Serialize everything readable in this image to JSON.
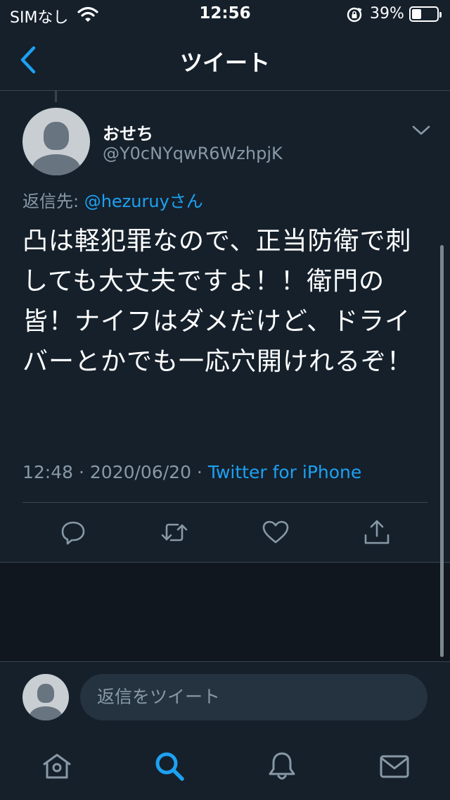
{
  "status_bar": {
    "carrier": "SIMなし",
    "time": "12:56",
    "battery_percent": "39%",
    "battery_level": 0.39
  },
  "nav": {
    "title": "ツイート",
    "back_icon": "chevron-left-icon"
  },
  "tweet": {
    "author_name": "おせち",
    "author_handle": "@Y0cNYqwR6WzhpjK",
    "reply_to_prefix": "返信先: ",
    "reply_to_mention": "@hezuruyさん",
    "text": "凸は軽犯罪なので、正当防衛で刺しても大丈夫ですよ！！衛門の皆！ナイフはダメだけど、ドライバーとかでも一応穴開けれるぞ！",
    "time": "12:48",
    "separator": " · ",
    "date": "2020/06/20",
    "source": "Twitter for iPhone",
    "actions": [
      "reply-icon",
      "retweet-icon",
      "like-icon",
      "share-icon"
    ]
  },
  "reply_bar": {
    "placeholder": "返信をツイート"
  },
  "tab_bar": {
    "tabs": [
      "home-icon",
      "search-icon",
      "notifications-icon",
      "messages-icon"
    ],
    "active": "search-icon"
  },
  "colors": {
    "background": "#15202b",
    "accent": "#1da1f2",
    "secondary_text": "#8899a6",
    "border": "#38444d"
  }
}
